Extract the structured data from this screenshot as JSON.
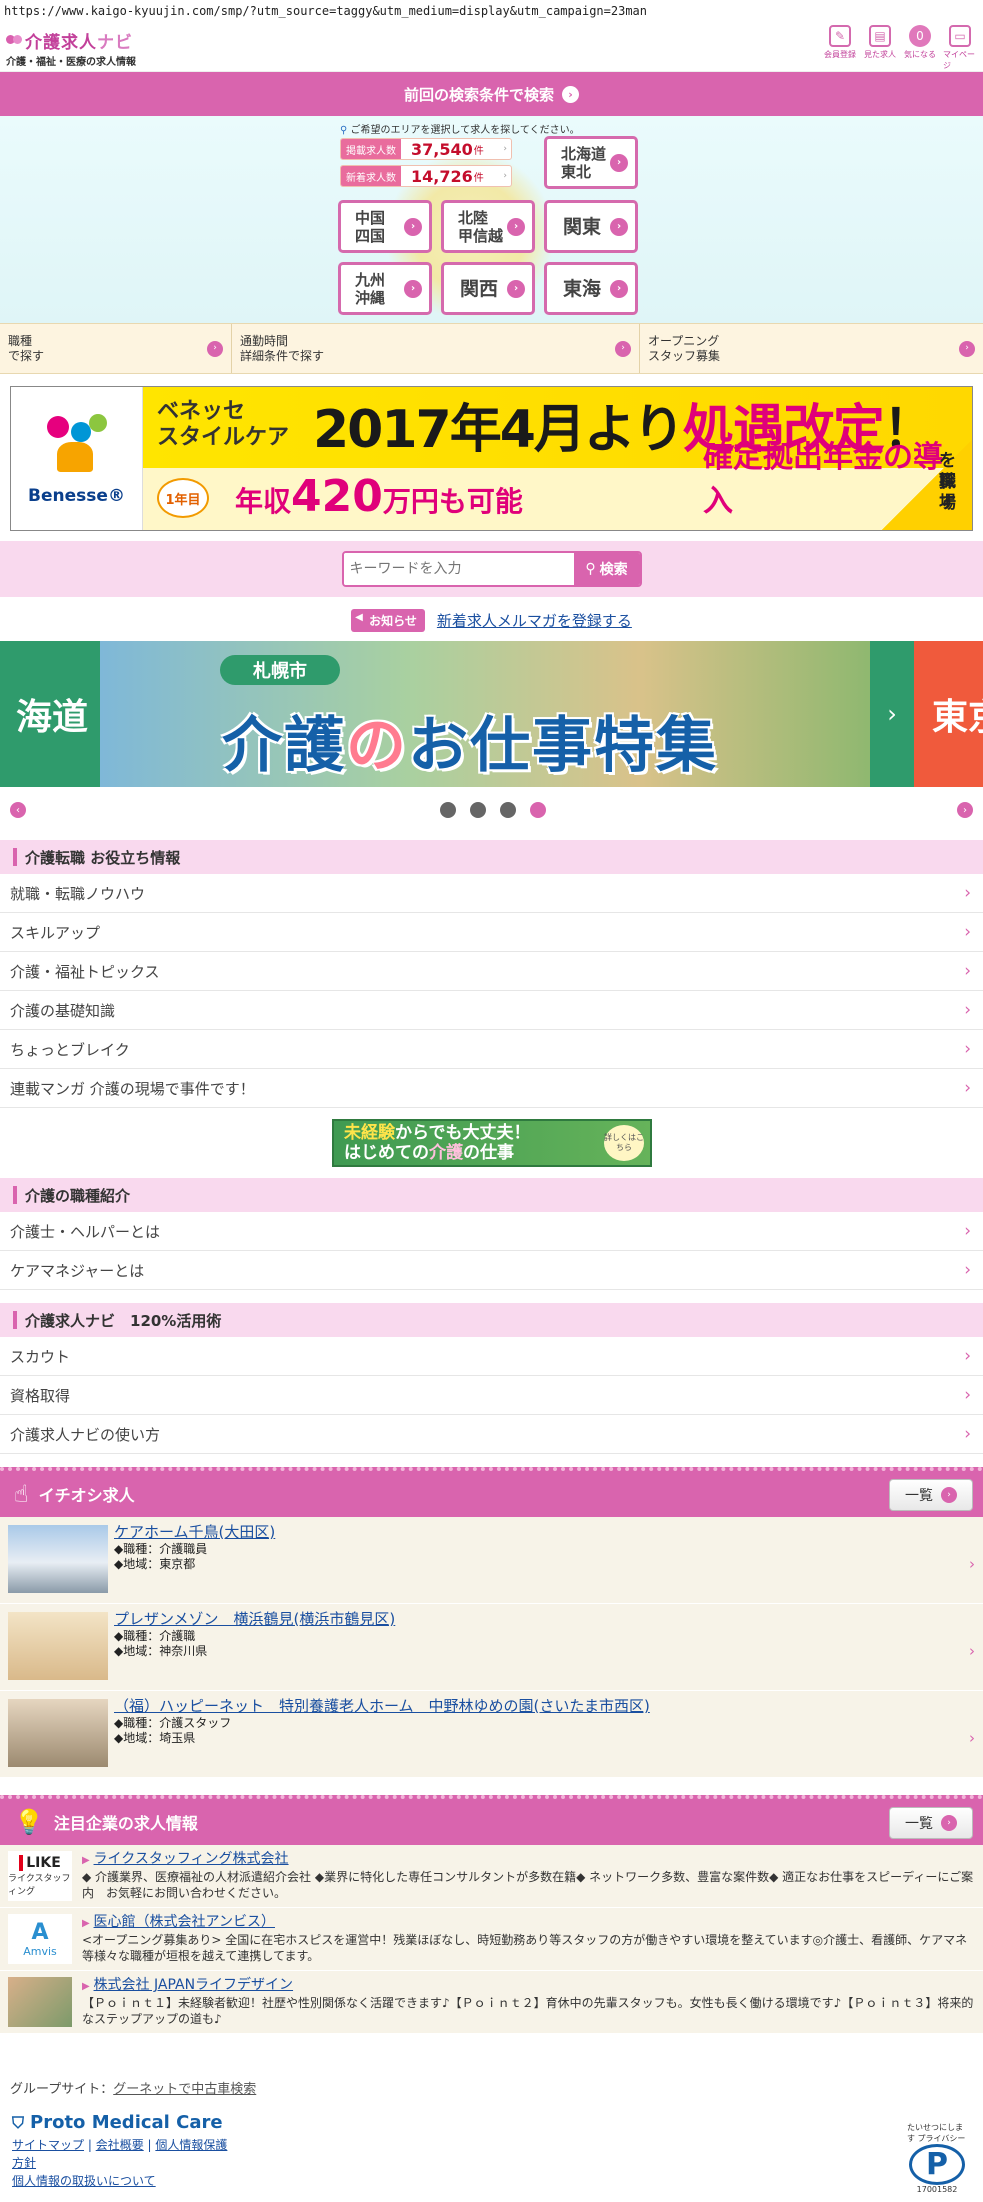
{
  "browser": {
    "url": "https://www.kaigo-kyuujin.com/smp/?utm_source=taggy&utm_medium=display&utm_campaign=23man"
  },
  "header": {
    "logo_title_a": "介護求人",
    "logo_title_b": "ナビ",
    "logo_tagline": "介護・福祉・医療の求人情報",
    "icons": [
      {
        "label": "会員登録",
        "icon": "pencil-icon"
      },
      {
        "label": "見た求人",
        "icon": "calendar-icon"
      },
      {
        "label": "気になる",
        "icon": "heart-icon",
        "badge": "0"
      },
      {
        "label": "マイページ",
        "icon": "book-icon"
      }
    ]
  },
  "prev_search": {
    "label": "前回の検索条件で検索"
  },
  "area": {
    "note": "ご希望のエリアを選択して求人を探してください。",
    "stats": [
      {
        "label": "掲載求人数",
        "value": "37,540",
        "unit": "件"
      },
      {
        "label": "新着求人数",
        "value": "14,726",
        "unit": "件"
      }
    ],
    "regions": {
      "hokkaido": [
        "北海道",
        "東北"
      ],
      "chugoku": [
        "中国",
        "四国"
      ],
      "hokuriku": [
        "北陸",
        "甲信越"
      ],
      "kanto": "関東",
      "kyushu": [
        "九州",
        "沖縄"
      ],
      "kansai": "関西",
      "tokai": "東海"
    }
  },
  "search_tabs": [
    [
      "職種",
      "で探す"
    ],
    [
      "通勤時間",
      "詳細条件で探す"
    ],
    [
      "オープニング",
      "スタッフ募集"
    ]
  ],
  "banner1": {
    "brand": "Benesse",
    "brand_mark": "®",
    "company_a": "ベネッセ",
    "company_b": "スタイルケア",
    "headline_a": "2017年4月より",
    "headline_b": "処遇改定",
    "headline_c": "！",
    "year_badge": "1年目",
    "salary_pre": "年収",
    "salary_num": "420",
    "salary_post": "万円も可能",
    "pension": "確定拠出年金の導入",
    "cta_a": "職場",
    "cta_b": "を探す"
  },
  "keyword": {
    "placeholder": "キーワードを入力",
    "button": "検索"
  },
  "notice": {
    "badge": "お知らせ",
    "link": "新着求人メルマガを登録する"
  },
  "banner2": {
    "left_text": "海道",
    "ribbon": "札幌市",
    "title_a": "介護",
    "title_b": "の",
    "title_c": "お仕事特集",
    "right_text": "東京"
  },
  "carousel": {
    "dots": 4,
    "active": 3
  },
  "sections": {
    "useful": {
      "title": "介護転職 お役立ち情報",
      "items": [
        "就職・転職ノウハウ",
        "スキルアップ",
        "介護・福祉トピックス",
        "介護の基礎知識",
        "ちょっとブレイク",
        "連載マンガ 介護の現場で事件です！"
      ]
    },
    "mini_banner": {
      "line1_a": "未経験",
      "line1_b": "からでも大丈夫！",
      "line2_a": "はじめての",
      "line2_b": "介護",
      "line2_c": "の仕事",
      "side": "詳しくはこちら"
    },
    "jobtypes": {
      "title": "介護の職種紹介",
      "items": [
        "介護士・ヘルパーとは",
        "ケアマネジャーとは"
      ]
    },
    "howto": {
      "title": "介護求人ナビ　120%活用術",
      "items": [
        "スカウト",
        "資格取得",
        "介護求人ナビの使い方"
      ]
    }
  },
  "featured": {
    "title": "イチオシ求人",
    "list_button": "一覧",
    "jobs": [
      {
        "name": "ケアホーム千鳥(大田区)",
        "type": "◆職種：介護職員",
        "area": "◆地域：東京都"
      },
      {
        "name": "プレザンメゾン　横浜鶴見(横浜市鶴見区)",
        "type": "◆職種：介護職",
        "area": "◆地域：神奈川県"
      },
      {
        "name": "（福）ハッピーネット　特別養護老人ホーム　中野林ゆめの園(さいたま市西区)",
        "type": "◆職種：介護スタッフ",
        "area": "◆地域：埼玉県"
      }
    ]
  },
  "companies": {
    "title": "注目企業の求人情報",
    "list_button": "一覧",
    "items": [
      {
        "logo": "LIKE",
        "logo_sub": "ライクスタッフィング",
        "name": "ライクスタッフィング株式会社",
        "desc": "◆ 介護業界、医療福祉の人材派遣紹介会社 ◆業界に特化した専任コンサルタントが多数在籍◆ ネットワーク多数、豊富な案件数◆ 適正なお仕事をスピーディーにご案内　お気軽にお問い合わせください。"
      },
      {
        "logo": "Amvis",
        "logo_sub": "",
        "name": "医心館（株式会社アンビス）",
        "desc": "<オープニング募集あり> 全国に在宅ホスピスを運営中！残業ほぼなし、時短勤務あり等スタッフの方が働きやすい環境を整えています◎介護士、看護師、ケアマネ等様々な職種が垣根を越えて連携してます。"
      },
      {
        "logo": "",
        "logo_sub": "",
        "name": "株式会社 JAPANライフデザイン",
        "desc": "【Ｐｏｉｎｔ１】未経験者歓迎！社歴や性別関係なく活躍できます♪【Ｐｏｉｎｔ２】育休中の先輩スタッフも。女性も長く働ける環境です♪【Ｐｏｉｎｔ３】将来的なステップアップの道も♪"
      }
    ]
  },
  "footer": {
    "group_label": "グループサイト：",
    "group_link": "グーネットで中古車検索",
    "brand": "Proto Medical Care",
    "links_row1": [
      "サイトマップ",
      "会社概要",
      "個人情報保護"
    ],
    "link_policy": "方針",
    "link_privacy": "個人情報の取扱いについて",
    "privacy_mark": "P",
    "privacy_text": "たいせつにします プライバシー",
    "privacy_num": "17001582"
  },
  "colors": {
    "accent": "#d964ae",
    "accent_light": "#f9d9ee",
    "stat_number": "#c40d2c"
  }
}
